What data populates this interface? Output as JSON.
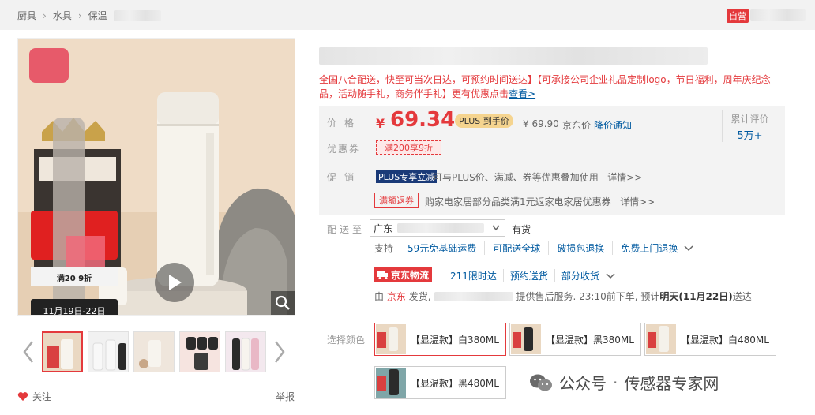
{
  "breadcrumb": {
    "items": [
      "厨具",
      "水具",
      "保温"
    ]
  },
  "store": {
    "self_operated": "自营"
  },
  "gallery": {
    "promo_tag": "满20 9折",
    "promo_date": "11月19日-22日"
  },
  "actions": {
    "follow": "关注",
    "report": "举报"
  },
  "product": {
    "subtitle_text": "全国八合配送，快至可当次日达，可预约时间送达】【可承接公司企业礼品定制logo，节日福利，周年庆纪念品，活动随手礼，商务伴手礼】更有优惠点击",
    "subtitle_link": "查看>"
  },
  "price": {
    "label": "价格",
    "currency": "¥",
    "value": "69.34",
    "plus_badge": "PLUS 到手价",
    "jd_price": "¥ 69.90",
    "jd_price_label": "京东价",
    "price_alert": "降价通知",
    "reviews_label": "累计评价",
    "reviews_count": "5万+"
  },
  "coupon": {
    "label": "优惠券",
    "tag": "满200享9折"
  },
  "promotion": {
    "label": "促销",
    "plus_tag": "PLUS专享立减",
    "plus_text": "可与PLUS价、满减、券等优惠叠加使用",
    "plus_details": "详情>>",
    "rebate_tag": "满额返券",
    "rebate_text": "购家电家居部分品类满1元返家电家居优惠券",
    "rebate_details": "详情>>"
  },
  "delivery": {
    "label": "配送至",
    "address": "广东",
    "stock": "有货",
    "services": [
      "支持",
      "59元免基础运费",
      "可配送全球",
      "破损包退换",
      "免费上门退换"
    ]
  },
  "logistics": {
    "badge": "京东物流",
    "options": [
      "211限时达",
      "预约送货",
      "部分收货"
    ],
    "ship_prefix": "由",
    "ship_from": "京东",
    "ship_mid": "发货,",
    "ship_suffix": "提供售后服务. 23:10前下单, 预计",
    "ship_date": "明天(11月22日)",
    "ship_end": "送达"
  },
  "variants": {
    "label": "选择颜色",
    "items": [
      {
        "label": "【显温款】白380ML",
        "color": "#f4f1ea"
      },
      {
        "label": "【显温款】黑380ML",
        "color": "#2b2b2b"
      },
      {
        "label": "【显温款】白480ML",
        "color": "#f4f1ea"
      },
      {
        "label": "【显温款】黑480ML",
        "color": "#2b2b2b"
      }
    ]
  },
  "watermark": {
    "account": "公众号",
    "dot": "·",
    "name": "传感器专家网"
  },
  "colors": {
    "accent_red": "#e4393c",
    "link_blue": "#005aa0",
    "plus_gold": "#f5d48f",
    "plus_navy": "#1a3a78"
  }
}
